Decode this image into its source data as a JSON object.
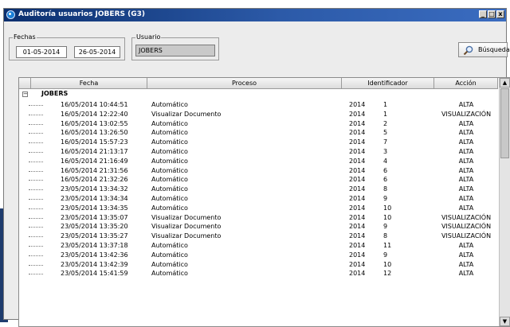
{
  "window": {
    "title": "Auditoría usuarios JOBERS (G3)",
    "buttons": [
      "_",
      "□",
      "x"
    ]
  },
  "filters": {
    "fechas_label": "Fechas",
    "fecha_desde": "01-05-2014",
    "fecha_hasta": "26-05-2014",
    "usuario_label": "Usuario",
    "usuario_value": "JOBERS",
    "search_label": "Búsqueda"
  },
  "grid": {
    "columns": [
      "Fecha",
      "Proceso",
      "Identificador",
      "Acción"
    ],
    "group": "JOBERS",
    "rows": [
      [
        "16/05/2014 10:44:51",
        "Automático",
        "2014",
        "1",
        "ALTA"
      ],
      [
        "16/05/2014 12:22:40",
        "Visualizar Documento",
        "2014",
        "1",
        "VISUALIZACIÓN"
      ],
      [
        "16/05/2014 13:02:55",
        "Automático",
        "2014",
        "2",
        "ALTA"
      ],
      [
        "16/05/2014 13:26:50",
        "Automático",
        "2014",
        "5",
        "ALTA"
      ],
      [
        "16/05/2014 15:57:23",
        "Automático",
        "2014",
        "7",
        "ALTA"
      ],
      [
        "16/05/2014 21:13:17",
        "Automático",
        "2014",
        "3",
        "ALTA"
      ],
      [
        "16/05/2014 21:16:49",
        "Automático",
        "2014",
        "4",
        "ALTA"
      ],
      [
        "16/05/2014 21:31:56",
        "Automático",
        "2014",
        "6",
        "ALTA"
      ],
      [
        "16/05/2014 21:32:26",
        "Automático",
        "2014",
        "6",
        "ALTA"
      ],
      [
        "23/05/2014 13:34:32",
        "Automático",
        "2014",
        "8",
        "ALTA"
      ],
      [
        "23/05/2014 13:34:34",
        "Automático",
        "2014",
        "9",
        "ALTA"
      ],
      [
        "23/05/2014 13:34:35",
        "Automático",
        "2014",
        "10",
        "ALTA"
      ],
      [
        "23/05/2014 13:35:07",
        "Visualizar Documento",
        "2014",
        "10",
        "VISUALIZACIÓN"
      ],
      [
        "23/05/2014 13:35:20",
        "Visualizar Documento",
        "2014",
        "9",
        "VISUALIZACIÓN"
      ],
      [
        "23/05/2014 13:35:27",
        "Visualizar Documento",
        "2014",
        "8",
        "VISUALIZACIÓN"
      ],
      [
        "23/05/2014 13:37:18",
        "Automático",
        "2014",
        "11",
        "ALTA"
      ],
      [
        "23/05/2014 13:42:36",
        "Automático",
        "2014",
        "9",
        "ALTA"
      ],
      [
        "23/05/2014 13:42:39",
        "Automático",
        "2014",
        "10",
        "ALTA"
      ],
      [
        "23/05/2014 15:41:59",
        "Automático",
        "2014",
        "12",
        "ALTA"
      ]
    ]
  },
  "scrollbar": {
    "up": "▲",
    "down": "▼"
  }
}
